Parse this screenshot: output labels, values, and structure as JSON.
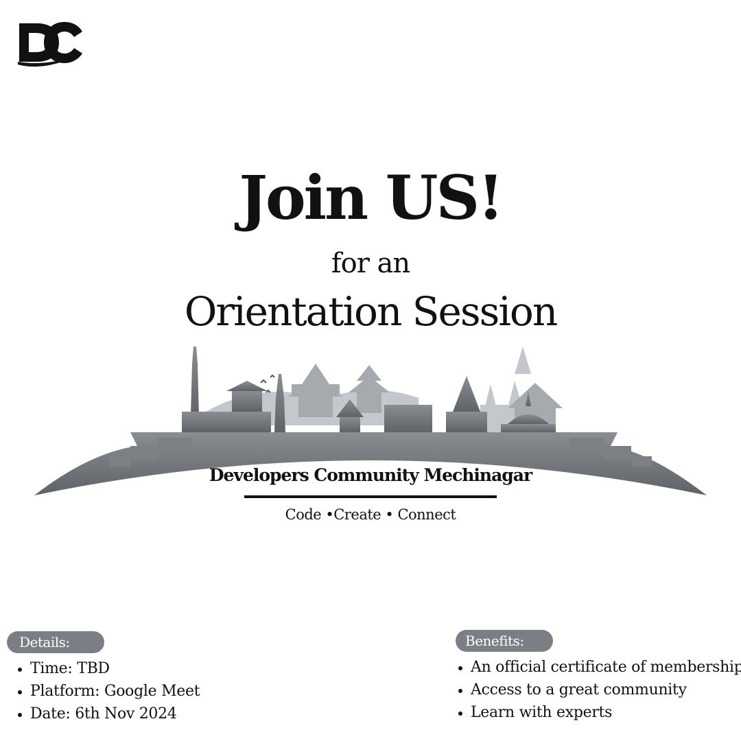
{
  "logo": {
    "brand": "DC"
  },
  "headline": {
    "title": "Join US!",
    "subtitle": "for an",
    "event": "Orientation Session"
  },
  "community": {
    "name": "Developers Community Mechinagar",
    "tagline": "Code  •Create • Connect"
  },
  "details": {
    "label": "Details:",
    "items": [
      "Time: TBD",
      "Platform: Google Meet",
      "Date: 6th Nov 2024"
    ]
  },
  "benefits": {
    "label": "Benefits:",
    "items": [
      "An official certificate of membership",
      "Access to a great community",
      "Learn with experts"
    ]
  },
  "colors": {
    "text": "#111111",
    "pill": "#7b7f85",
    "skyline_dark": "#6e7176",
    "skyline_light": "#b9bcc0"
  }
}
